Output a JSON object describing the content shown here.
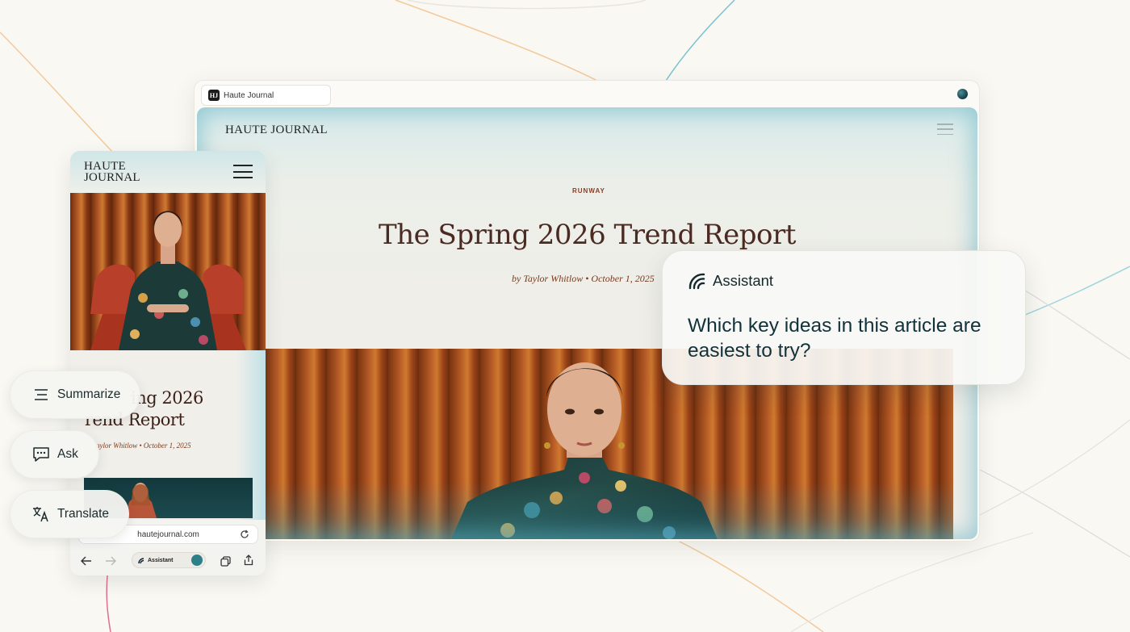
{
  "browser": {
    "tab_title": "Haute Journal",
    "tab_icon": "haute-journal-favicon",
    "profile_icon": "profile-avatar"
  },
  "article": {
    "site_name": "HAUTE JOURNAL",
    "category": "RUNWAY",
    "headline": "The Spring 2026 Trend Report",
    "byline": "by Taylor Whitlow • October 1, 2025"
  },
  "mobile": {
    "site_name_line1": "HAUTE",
    "site_name_line2": "JOURNAL",
    "headline_line1": "ing 2026",
    "headline_line2": "rend Report",
    "byline": "aylor Whitlow • October 1, 2025",
    "url": "hautejournal.com",
    "assistant_label": "Assistant"
  },
  "actions": {
    "summarize": "Summarize",
    "ask": "Ask",
    "translate": "Translate"
  },
  "assistant": {
    "name": "Assistant",
    "question": "Which key ideas in this article are easiest to try?"
  },
  "colors": {
    "accent_teal": "#2d7f88",
    "headline_brown": "#4a2a22",
    "category_rust": "#8a3b21"
  }
}
